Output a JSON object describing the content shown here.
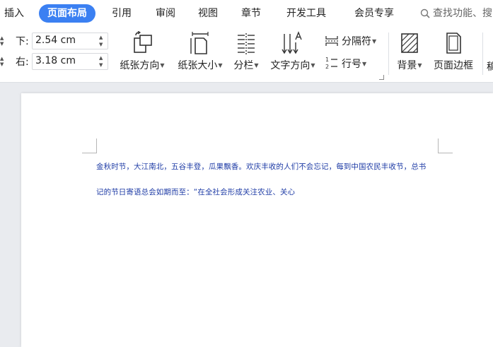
{
  "menu": {
    "items": [
      {
        "id": "insert",
        "label": "插入"
      },
      {
        "id": "page-layout",
        "label": "页面布局"
      },
      {
        "id": "references",
        "label": "引用"
      },
      {
        "id": "review",
        "label": "审阅"
      },
      {
        "id": "view",
        "label": "视图"
      },
      {
        "id": "chapter",
        "label": "章节"
      },
      {
        "id": "developer",
        "label": "开发工具"
      },
      {
        "id": "member",
        "label": "会员专享"
      }
    ],
    "search_label": "查找功能、搜"
  },
  "ribbon": {
    "margin_bottom": {
      "label": "下:",
      "value": "2.54 cm"
    },
    "margin_right": {
      "label": "右:",
      "value": "3.18 cm"
    },
    "orientation_label": "纸张方向",
    "size_label": "纸张大小",
    "columns_label": "分栏",
    "text_direction_label": "文字方向",
    "separator_label": "分隔符",
    "line_number_label": "行号",
    "background_label": "背景",
    "page_border_label": "页面边框",
    "cut_label": "稿"
  },
  "document": {
    "line1": "金秋时节，大江南北，五谷丰登，瓜果飘香。欢庆丰收的人们不会忘记，每到中国农民丰收节，总书",
    "line2": "记的节日寄语总会如期而至：“在全社会形成关注农业、关心"
  },
  "colors": {
    "accent": "#3b80f2",
    "doc_text": "#1f3ca6"
  }
}
